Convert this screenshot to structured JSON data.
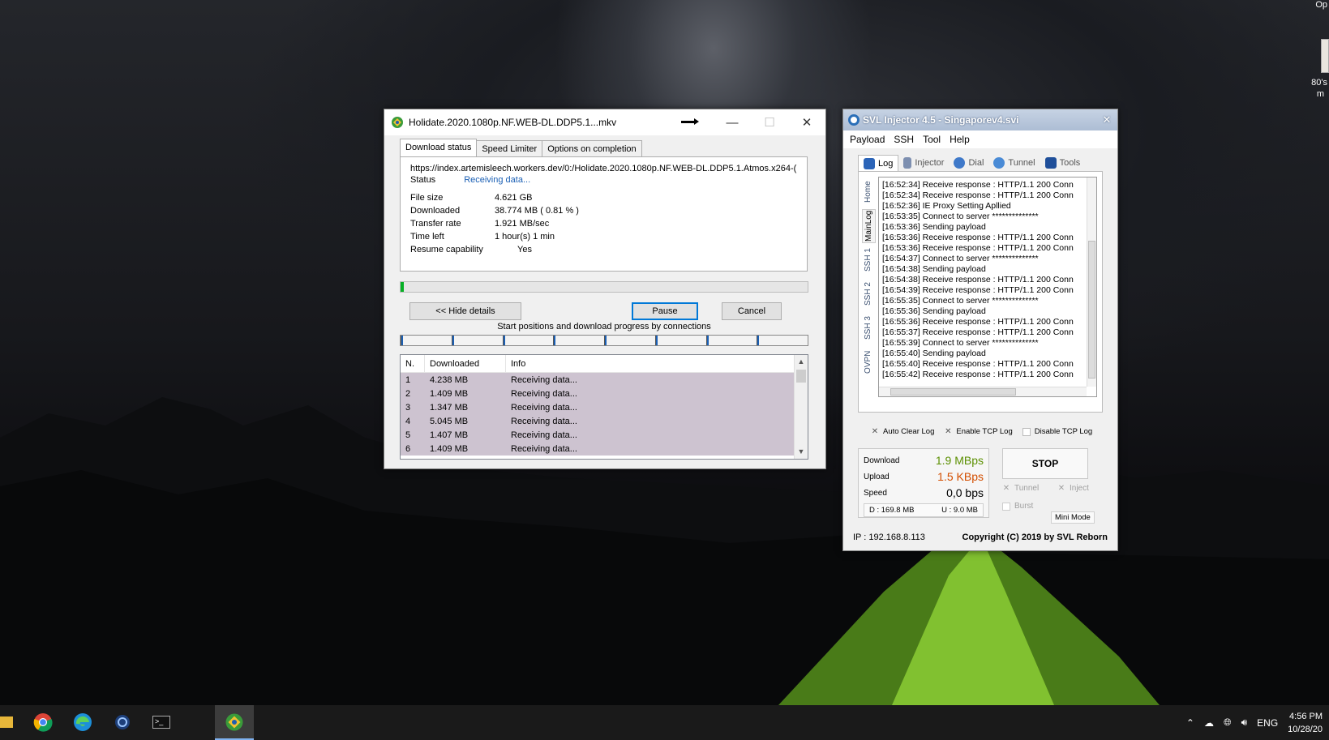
{
  "desktop": {
    "top_right_label": "Op",
    "icon_label_1": "80's",
    "icon_label_2": "m"
  },
  "idm": {
    "title": "Holidate.2020.1080p.NF.WEB-DL.DDP5.1...mkv",
    "tabs": [
      "Download status",
      "Speed Limiter",
      "Options on completion"
    ],
    "url": "https://index.artemisleech.workers.dev/0:/Holidate.2020.1080p.NF.WEB-DL.DDP5.1.Atmos.x264-(",
    "status_label": "Status",
    "status_value": "Receiving data...",
    "file_size_label": "File size",
    "file_size": "4.621  GB",
    "downloaded_label": "Downloaded",
    "downloaded": "38.774  MB  ( 0.81 % )",
    "transfer_rate_label": "Transfer rate",
    "transfer_rate": "1.921  MB/sec",
    "time_left_label": "Time left",
    "time_left": "1 hour(s) 1 min",
    "resume_label": "Resume capability",
    "resume_value": "Yes",
    "progress_percent": 0.81,
    "hide_details_label": "<< Hide details",
    "pause_label": "Pause",
    "cancel_label": "Cancel",
    "connections_caption": "Start positions and download progress by connections",
    "connection_count": 8,
    "table_headers": [
      "N.",
      "Downloaded",
      "Info"
    ],
    "connections": [
      {
        "n": "1",
        "downloaded": "4.238  MB",
        "info": "Receiving data..."
      },
      {
        "n": "2",
        "downloaded": "1.409  MB",
        "info": "Receiving data..."
      },
      {
        "n": "3",
        "downloaded": "1.347  MB",
        "info": "Receiving data..."
      },
      {
        "n": "4",
        "downloaded": "5.045  MB",
        "info": "Receiving data..."
      },
      {
        "n": "5",
        "downloaded": "1.407  MB",
        "info": "Receiving data..."
      },
      {
        "n": "6",
        "downloaded": "1.409  MB",
        "info": "Receiving data..."
      }
    ]
  },
  "svl": {
    "title": "SVL Injector 4.5 - Singaporev4.svi",
    "menu": [
      "Payload",
      "SSH",
      "Tool",
      "Help"
    ],
    "tabs": [
      "Log",
      "Injector",
      "Dial",
      "Tunnel",
      "Tools"
    ],
    "side_tabs": [
      "Home",
      "MainLog",
      "SSH 1",
      "SSH 2",
      "SSH 3",
      "OVPN"
    ],
    "log": [
      "[16:52:34] Receive response : HTTP/1.1 200 Conn",
      "[16:52:34] Receive response : HTTP/1.1 200 Conn",
      "[16:52:36] IE Proxy Setting Apllied",
      "[16:53:35] Connect to server **************",
      "[16:53:36] Sending payload",
      "[16:53:36] Receive response : HTTP/1.1 200 Conn",
      "[16:53:36] Receive response : HTTP/1.1 200 Conn",
      "[16:54:37] Connect to server **************",
      "[16:54:38] Sending payload",
      "[16:54:38] Receive response : HTTP/1.1 200 Conn",
      "[16:54:39] Receive response : HTTP/1.1 200 Conn",
      "[16:55:35] Connect to server **************",
      "[16:55:36] Sending payload",
      "[16:55:36] Receive response : HTTP/1.1 200 Conn",
      "[16:55:37] Receive response : HTTP/1.1 200 Conn",
      "[16:55:39] Connect to server **************",
      "[16:55:40] Sending payload",
      "[16:55:40] Receive response : HTTP/1.1 200 Conn",
      "[16:55:42] Receive response : HTTP/1.1 200 Conn"
    ],
    "auto_clear_log": "Auto Clear Log",
    "enable_tcp_log": "Enable TCP Log",
    "disable_tcp_log": "Disable TCP Log",
    "download_label": "Download",
    "download_value": "1.9 MBps",
    "upload_label": "Upload",
    "upload_value": "1.5 KBps",
    "speed_label": "Speed",
    "speed_value": "0,0 bps",
    "total_down": "D : 169.8 MB",
    "total_up": "U :    9.0 MB",
    "stop_label": "STOP",
    "tunnel_label": "Tunnel",
    "inject_label": "Inject",
    "burst_label": "Burst",
    "mini_mode_label": "Mini Mode",
    "ip": "IP : 192.168.8.113",
    "copyright": "Copyright (C) 2019 by SVL Reborn",
    "download_color": "#5b8f00",
    "upload_color": "#d34e00"
  },
  "taskbar": {
    "tray_language": "ENG",
    "time": "4:56 PM",
    "date": "10/28/20"
  }
}
